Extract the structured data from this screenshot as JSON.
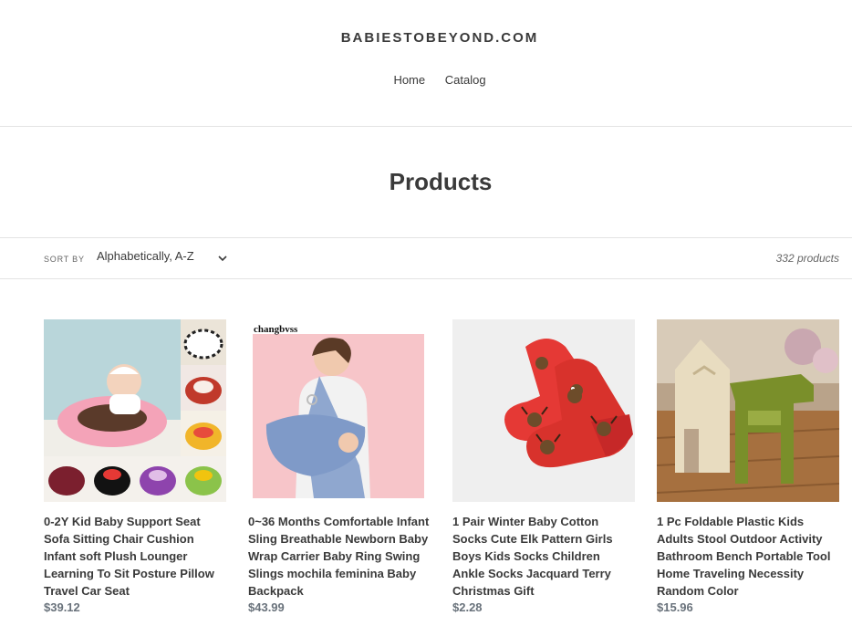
{
  "header": {
    "logo": "BABIESTOBEYOND.COM",
    "nav": [
      "Home",
      "Catalog"
    ]
  },
  "page_title": "Products",
  "filters": {
    "sort_label": "SORT BY",
    "sort_value": "Alphabetically, A-Z",
    "count": "332 products"
  },
  "products": [
    {
      "title": "0-2Y Kid Baby Support Seat Sofa Sitting Chair Cushion Infant soft Plush Lounger Learning To Sit Posture Pillow Travel Car Seat",
      "price": "$39.12",
      "image": "baby-support-seat-photo"
    },
    {
      "title": "0~36 Months Comfortable Infant Sling Breathable Newborn Baby Wrap Carrier Baby Ring Swing Slings mochila feminina Baby Backpack",
      "price": "$43.99",
      "image": "baby-sling-photo",
      "watermark": "changbvss"
    },
    {
      "title": "1 Pair Winter Baby Cotton Socks Cute Elk Pattern Girls Boys Kids Socks Children Ankle Socks Jacquard Terry Christmas Gift",
      "price": "$2.28",
      "image": "elk-socks-photo"
    },
    {
      "title": "1 Pc Foldable Plastic Kids Adults Stool Outdoor Activity Bathroom Bench Portable Tool Home Traveling Necessity Random Color",
      "price": "$15.96",
      "image": "folding-stool-photo"
    }
  ]
}
